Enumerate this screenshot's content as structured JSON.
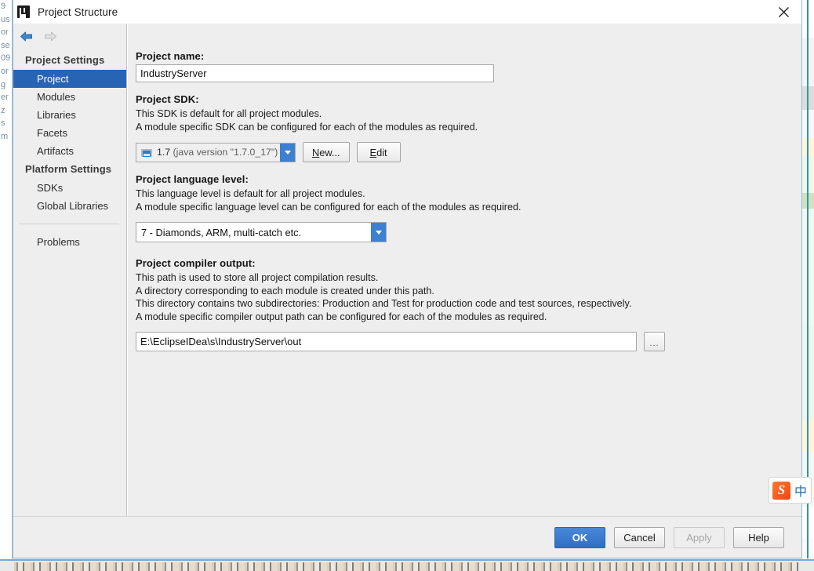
{
  "window": {
    "title": "Project Structure",
    "app_icon": "intellij-idea-icon",
    "close_icon": "close-icon"
  },
  "nav": {
    "back_icon": "arrow-back-icon",
    "forward_icon": "arrow-forward-icon"
  },
  "sidebar": {
    "groups": [
      {
        "header": "Project Settings",
        "items": [
          {
            "label": "Project",
            "selected": true
          },
          {
            "label": "Modules",
            "selected": false
          },
          {
            "label": "Libraries",
            "selected": false
          },
          {
            "label": "Facets",
            "selected": false
          },
          {
            "label": "Artifacts",
            "selected": false
          }
        ]
      },
      {
        "header": "Platform Settings",
        "items": [
          {
            "label": "SDKs",
            "selected": false
          },
          {
            "label": "Global Libraries",
            "selected": false
          }
        ]
      }
    ],
    "problems": "Problems"
  },
  "project_name": {
    "label": "Project name:",
    "value": "IndustryServer"
  },
  "project_sdk": {
    "label": "Project SDK:",
    "desc_line1": "This SDK is default for all project modules.",
    "desc_line2": "A module specific SDK can be configured for each of the modules as required.",
    "selected_version": "1.7",
    "selected_detail": "(java version \"1.7.0_17\")",
    "sdk_icon": "jdk-folder-icon",
    "dropdown_icon": "chevron-down-icon",
    "new_button": "New...",
    "edit_button": "Edit"
  },
  "language_level": {
    "label": "Project language level:",
    "desc_line1": "This language level is default for all project modules.",
    "desc_line2": "A module specific language level can be configured for each of the modules as required.",
    "selected": "7 - Diamonds, ARM, multi-catch etc.",
    "dropdown_icon": "chevron-down-icon"
  },
  "compiler_output": {
    "label": "Project compiler output:",
    "desc_line1": "This path is used to store all project compilation results.",
    "desc_line2": "A directory corresponding to each module is created under this path.",
    "desc_line3": "This directory contains two subdirectories: Production and Test for production code and test sources, respectively.",
    "desc_line4": "A module specific compiler output path can be configured for each of the modules as required.",
    "path": "E:\\EclipseIDea\\s\\IndustryServer\\out",
    "browse_button": "..."
  },
  "footer": {
    "ok": "OK",
    "cancel": "Cancel",
    "apply": "Apply",
    "help": "Help"
  },
  "ime": {
    "logo": "sogou-logo-icon",
    "mode": "中"
  },
  "background": {
    "left_fragments": [
      "9",
      "",
      "us",
      "or",
      "se",
      "09",
      "or",
      "g",
      "er",
      "z",
      "s",
      "",
      "",
      "",
      "m"
    ]
  },
  "colors": {
    "accent_blue": "#2864b4",
    "primary_button": "#3d7fd0",
    "dialog_bg": "#eeeeee",
    "teal_line": "#2f9a9a"
  }
}
